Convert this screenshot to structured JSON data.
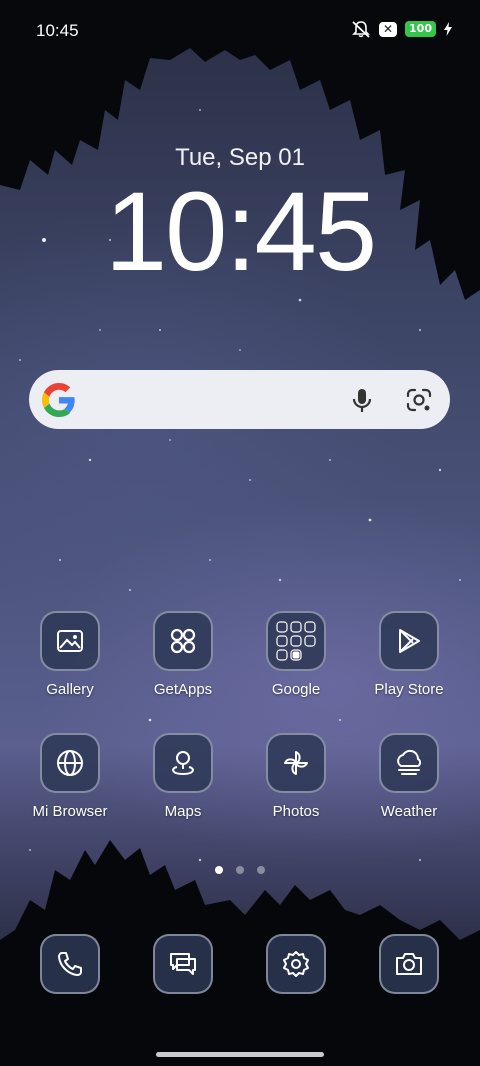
{
  "status_bar": {
    "time": "10:45",
    "battery": "100",
    "icons": [
      "mute-icon",
      "sim-x-icon",
      "battery-icon",
      "charging-bolt-icon"
    ],
    "sim_mark": "✕"
  },
  "clock_widget": {
    "date": "Tue, Sep 01",
    "time": "10:45"
  },
  "search_bar": {
    "icons": [
      "google-logo-icon",
      "mic-icon",
      "lens-icon"
    ],
    "colors": {
      "blue": "#4285F4",
      "red": "#EA4335",
      "yellow": "#FBBC05",
      "green": "#34A853"
    }
  },
  "apps": [
    {
      "label": "Gallery",
      "icon": "gallery-icon"
    },
    {
      "label": "GetApps",
      "icon": "getapps-icon"
    },
    {
      "label": "Google",
      "icon": "google-folder-icon"
    },
    {
      "label": "Play Store",
      "icon": "play-store-icon"
    },
    {
      "label": "Mi Browser",
      "icon": "globe-icon"
    },
    {
      "label": "Maps",
      "icon": "maps-pin-icon"
    },
    {
      "label": "Photos",
      "icon": "pinwheel-icon"
    },
    {
      "label": "Weather",
      "icon": "weather-icon"
    }
  ],
  "page_indicator": {
    "pages": 3,
    "current": 1
  },
  "dock": [
    {
      "icon": "phone-icon"
    },
    {
      "icon": "messages-icon"
    },
    {
      "icon": "settings-icon"
    },
    {
      "icon": "camera-icon"
    }
  ]
}
